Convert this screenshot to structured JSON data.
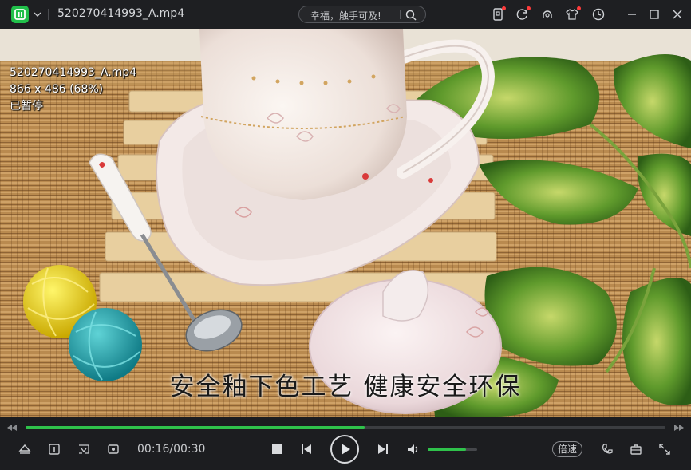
{
  "titlebar": {
    "file_name": "520270414993_A.mp4",
    "search_placeholder": "幸福，触手可及!",
    "logo_color": "#21c04a",
    "right_icons": [
      "phone-icon",
      "refresh-icon",
      "cloud-icon",
      "shirt-icon",
      "clock-icon",
      "minimize-icon",
      "maximize-icon",
      "close-icon"
    ]
  },
  "video": {
    "osd": {
      "file_name": "520270414993_A.mp4",
      "resolution": "866 x 486 (68%)",
      "status": "已暂停"
    },
    "subtitle": "安全釉下色工艺 健康安全环保"
  },
  "controls": {
    "progress_fraction": 0.53,
    "time": "00:16/00:30",
    "volume_fraction": 0.78,
    "speed_label": "倍速",
    "accent_color": "#2fc24b",
    "left_icons": [
      "eject-icon",
      "subtitle-icon",
      "screenshot-icon",
      "record-icon"
    ],
    "transport_icons": [
      "stop-icon",
      "previous-icon",
      "play-icon",
      "next-icon",
      "volume-icon"
    ],
    "right_icons": [
      "cast-icon",
      "toolbox-icon",
      "fullscreen-icon"
    ]
  }
}
